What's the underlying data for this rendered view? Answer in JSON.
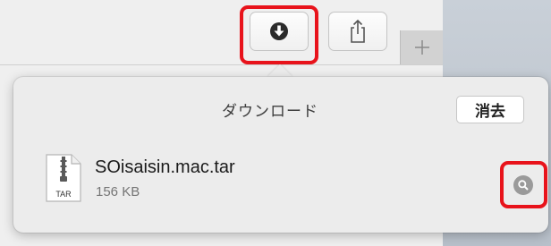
{
  "toolbar": {
    "download_icon": "download-arrow-icon",
    "share_icon": "share-icon",
    "new_tab_icon": "plus-icon",
    "new_tab_label": "+"
  },
  "downloads": {
    "title": "ダウンロード",
    "clear_label": "消去",
    "items": [
      {
        "name": "SOisaisin.mac.tar",
        "size": "156 KB",
        "file_type_label": "TAR",
        "icon": "tar-archive-icon",
        "reveal_icon": "magnifier-icon"
      }
    ]
  },
  "colors": {
    "highlight": "#e8131b",
    "popover_bg": "#ececec",
    "toolbar_bg": "#efefef"
  }
}
